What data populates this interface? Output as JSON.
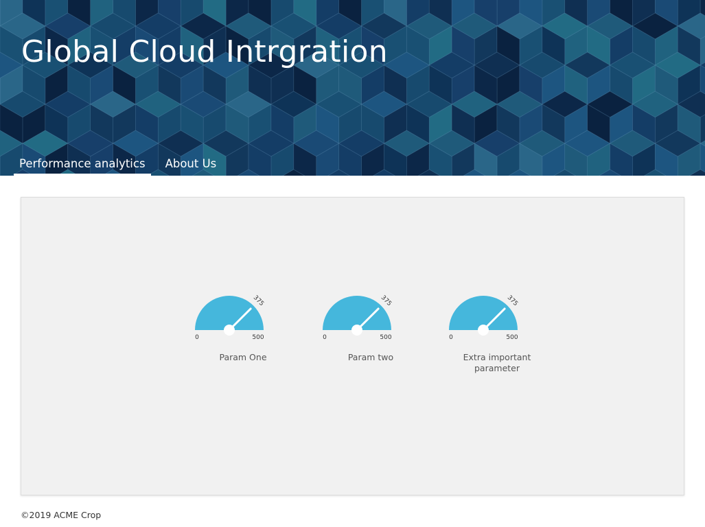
{
  "app": {
    "title": "Global Cloud Intrgration"
  },
  "nav": {
    "tabs": [
      {
        "label": "Performance analytics",
        "active": true
      },
      {
        "label": "About Us",
        "active": false
      }
    ]
  },
  "gauges": [
    {
      "label": "Param One",
      "min": "0",
      "max": "500",
      "value": "375"
    },
    {
      "label": "Param two",
      "min": "0",
      "max": "500",
      "value": "375"
    },
    {
      "label": "Extra important parameter",
      "min": "0",
      "max": "500",
      "value": "375"
    }
  ],
  "colors": {
    "gauge_fill": "#45b7dc",
    "needle": "#ffffff",
    "panel_bg": "#f1f1f1"
  },
  "footer": {
    "text": "©2019 ACME Crop"
  }
}
